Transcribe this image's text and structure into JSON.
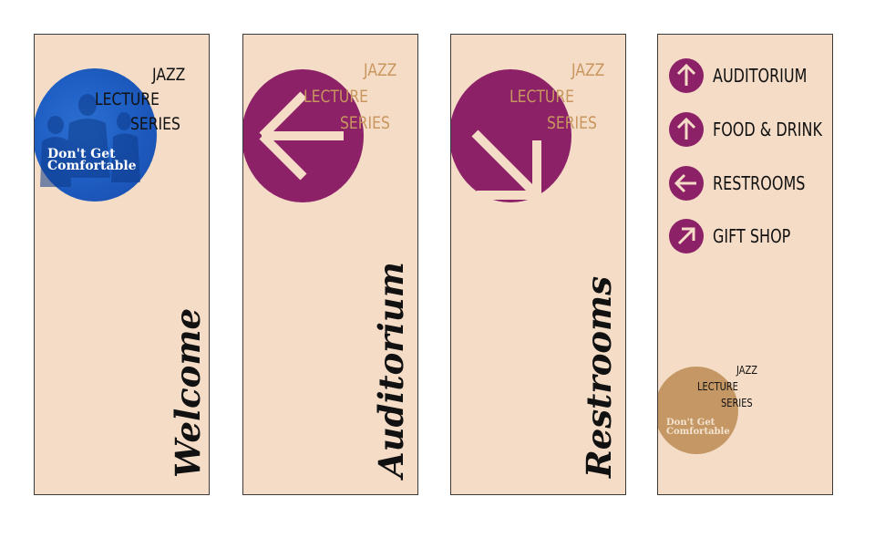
{
  "logo": {
    "line1": "JAZZ",
    "line2": "LECTURE",
    "line3": "SERIES",
    "tagline_line1": "Don't Get",
    "tagline_line2": "Comfortable"
  },
  "panels": [
    {
      "title": "Welcome"
    },
    {
      "title": "Auditorium",
      "arrow": "arrow-left-icon"
    },
    {
      "title": "Restrooms",
      "arrow": "arrow-down-right-icon"
    }
  ],
  "directory": [
    {
      "label": "AUDITORIUM",
      "icon": "arrow-up-icon"
    },
    {
      "label": "FOOD & DRINK",
      "icon": "arrow-up-icon"
    },
    {
      "label": "RESTROOMS",
      "icon": "arrow-left-icon"
    },
    {
      "label": "GIFT SHOP",
      "icon": "arrow-up-right-icon"
    }
  ],
  "colors": {
    "panel_bg": "#f4dcc6",
    "purple": "#8c2168",
    "blue": "#1f5fc4",
    "tan": "#c49765",
    "gold_text": "#c8965e"
  }
}
